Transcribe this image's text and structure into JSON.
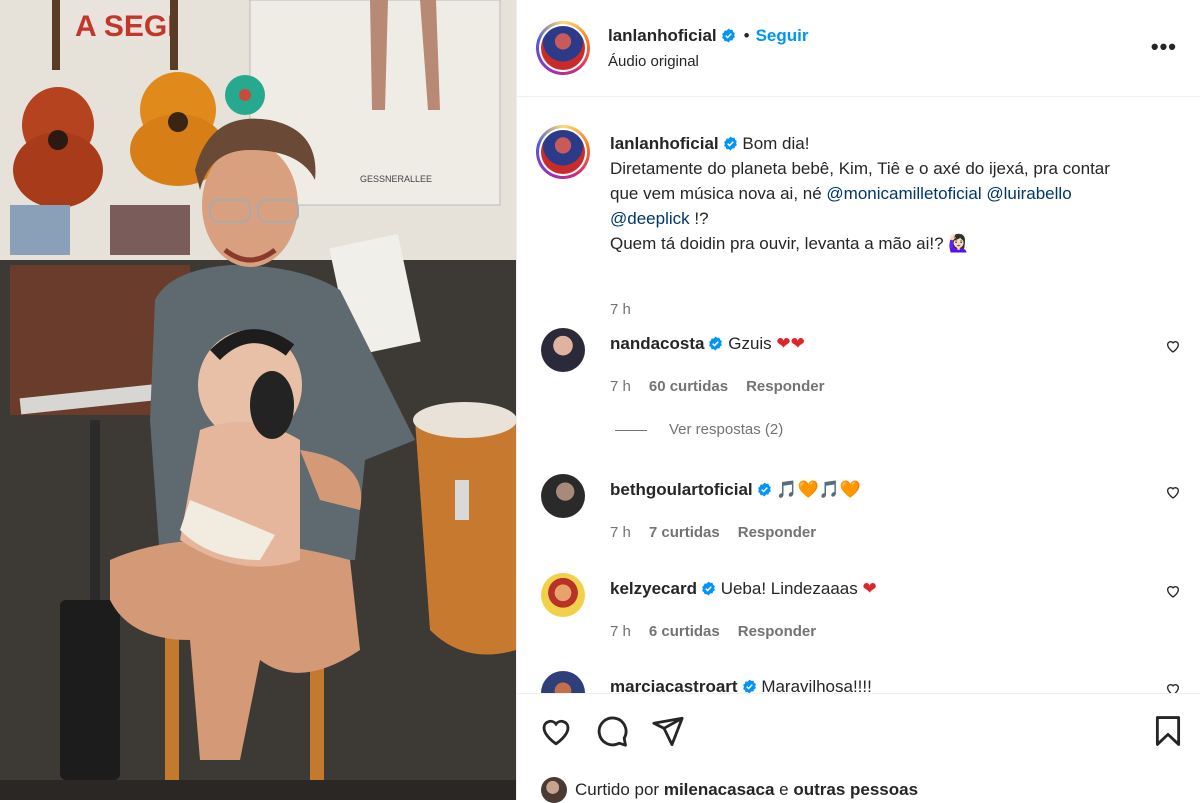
{
  "post": {
    "username": "lanlanhoficial",
    "follow_label": "Seguir",
    "dot": "•",
    "audio_label": "Áudio original",
    "more_label": "•••"
  },
  "caption": {
    "username": "lanlanhoficial",
    "line1": "Bom dia!",
    "line2": "Diretamente do planeta bebê, Kim, Tiê e o axé do ijexá, pra contar",
    "line3_prefix": "que vem música nova ai, né ",
    "mention1": "@monicamilletoficial",
    "mention2": "@luirabello",
    "mention3": "@deeplick",
    "line4_suffix": " !?",
    "line5": "Quem tá doidin pra ouvir, levanta a mão ai!? 🙋🏻‍♀️",
    "time": "7 h"
  },
  "comments": [
    {
      "username": "nandacosta",
      "text": "Gzuis",
      "emoji": "❤❤",
      "time": "7 h",
      "likes": "60 curtidas",
      "reply": "Responder"
    },
    {
      "username": "bethgoulartoficial",
      "text": "",
      "emoji": "🎵🧡🎵🧡",
      "time": "7 h",
      "likes": "7 curtidas",
      "reply": "Responder"
    },
    {
      "username": "kelzyecard",
      "text": "Ueba! Lindezaaas",
      "emoji": "❤",
      "time": "7 h",
      "likes": "6 curtidas",
      "reply": "Responder"
    },
    {
      "username": "marciacastroart",
      "text": "Maravilhosa!!!!",
      "emoji": "",
      "time": "",
      "likes": "",
      "reply": ""
    }
  ],
  "view_replies": "Ver respostas (2)",
  "liked_by": {
    "prefix": "Curtido por ",
    "user": "milenacasaca",
    "middle": " e ",
    "others": "outras pessoas"
  },
  "colors": {
    "link": "#0095f6",
    "mention": "#00376b",
    "muted": "#737373",
    "heart": "#ed1c24"
  },
  "icons": [
    "verified-badge-icon",
    "heart-icon",
    "comment-icon",
    "share-icon",
    "bookmark-icon",
    "more-icon"
  ]
}
